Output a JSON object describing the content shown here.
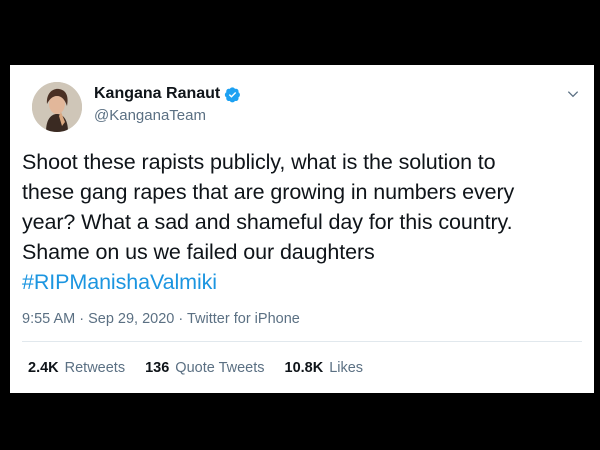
{
  "user": {
    "display_name": "Kangana Ranaut",
    "handle": "@KanganaTeam"
  },
  "tweet": {
    "lines": [
      "Shoot these rapists publicly, what is the solution to",
      "these gang rapes that are growing in numbers every",
      "year? What a sad and shameful day for this country.",
      "Shame on us we failed our daughters"
    ],
    "hashtag": "#RIPManishaValmiki"
  },
  "meta": {
    "time": "9:55 AM",
    "separator1": " · ",
    "date": "Sep 29, 2020",
    "separator2": " · ",
    "source": "Twitter for iPhone"
  },
  "stats": {
    "retweets_count": "2.4K",
    "retweets_label": "Retweets",
    "quotes_count": "136",
    "quotes_label": "Quote Tweets",
    "likes_count": "10.8K",
    "likes_label": "Likes"
  },
  "icons": {
    "verified": "verified-badge-icon",
    "menu": "chevron-down-icon"
  },
  "colors": {
    "link": "#1b95e0",
    "verified": "#1da1f2",
    "secondary_text": "#5b7083",
    "background": "#000000"
  }
}
